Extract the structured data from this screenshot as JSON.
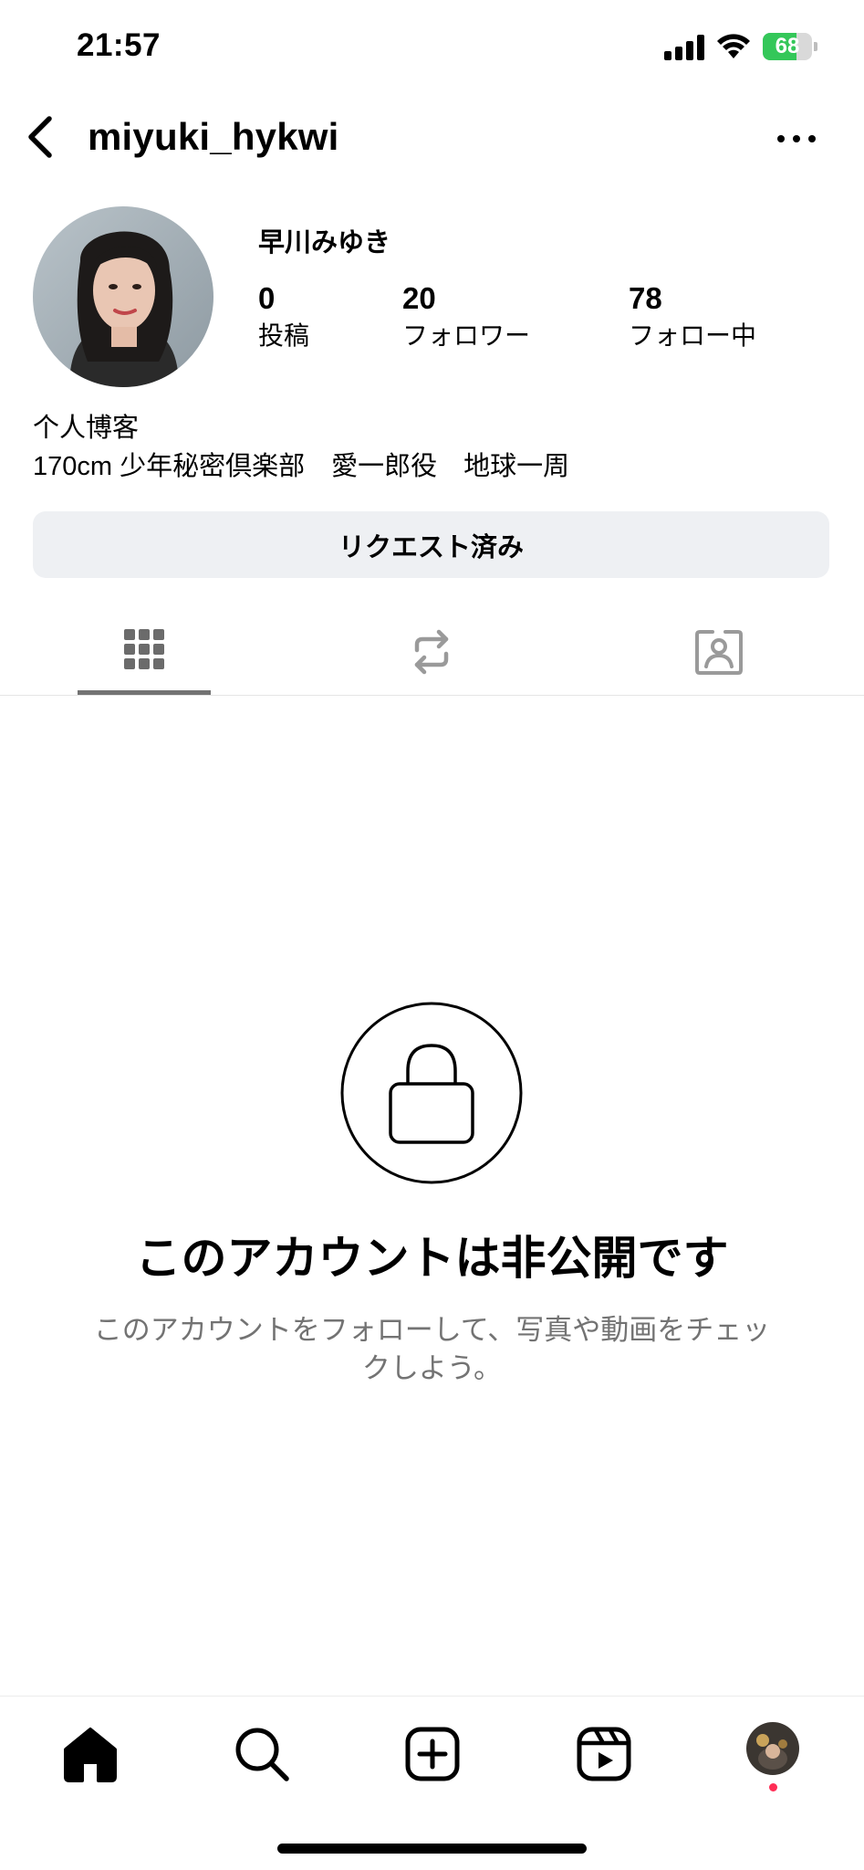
{
  "status_bar": {
    "time": "21:57",
    "battery": "68",
    "battery_level": 0.68
  },
  "header": {
    "username": "miyuki_hykwi"
  },
  "profile": {
    "display_name": "早川みゆき",
    "stats": [
      {
        "number": "0",
        "label": "投稿"
      },
      {
        "number": "20",
        "label": "フォロワー"
      },
      {
        "number": "78",
        "label": "フォロー中"
      }
    ],
    "bio_line1": "个人博客",
    "bio_line2": "170cm 少年秘密倶楽部　愛一郎役　地球一周"
  },
  "actions": {
    "request_label": "リクエスト済み"
  },
  "tabs": [
    {
      "icon": "grid-icon",
      "active": true
    },
    {
      "icon": "reposts-icon",
      "active": false
    },
    {
      "icon": "tagged-icon",
      "active": false
    }
  ],
  "private_notice": {
    "title": "このアカウントは非公開です",
    "description_line1": "このアカウントをフォローして、写真や動画をチェッ",
    "description_line2": "クしよう。"
  },
  "bottom_nav": [
    "home-icon",
    "search-icon",
    "create-icon",
    "reels-icon",
    "profile-avatar"
  ],
  "colors": {
    "accent_battery": "#34c759",
    "secondary_text": "#737373",
    "button_bg": "#eef0f3",
    "notification": "#ff2d55"
  }
}
